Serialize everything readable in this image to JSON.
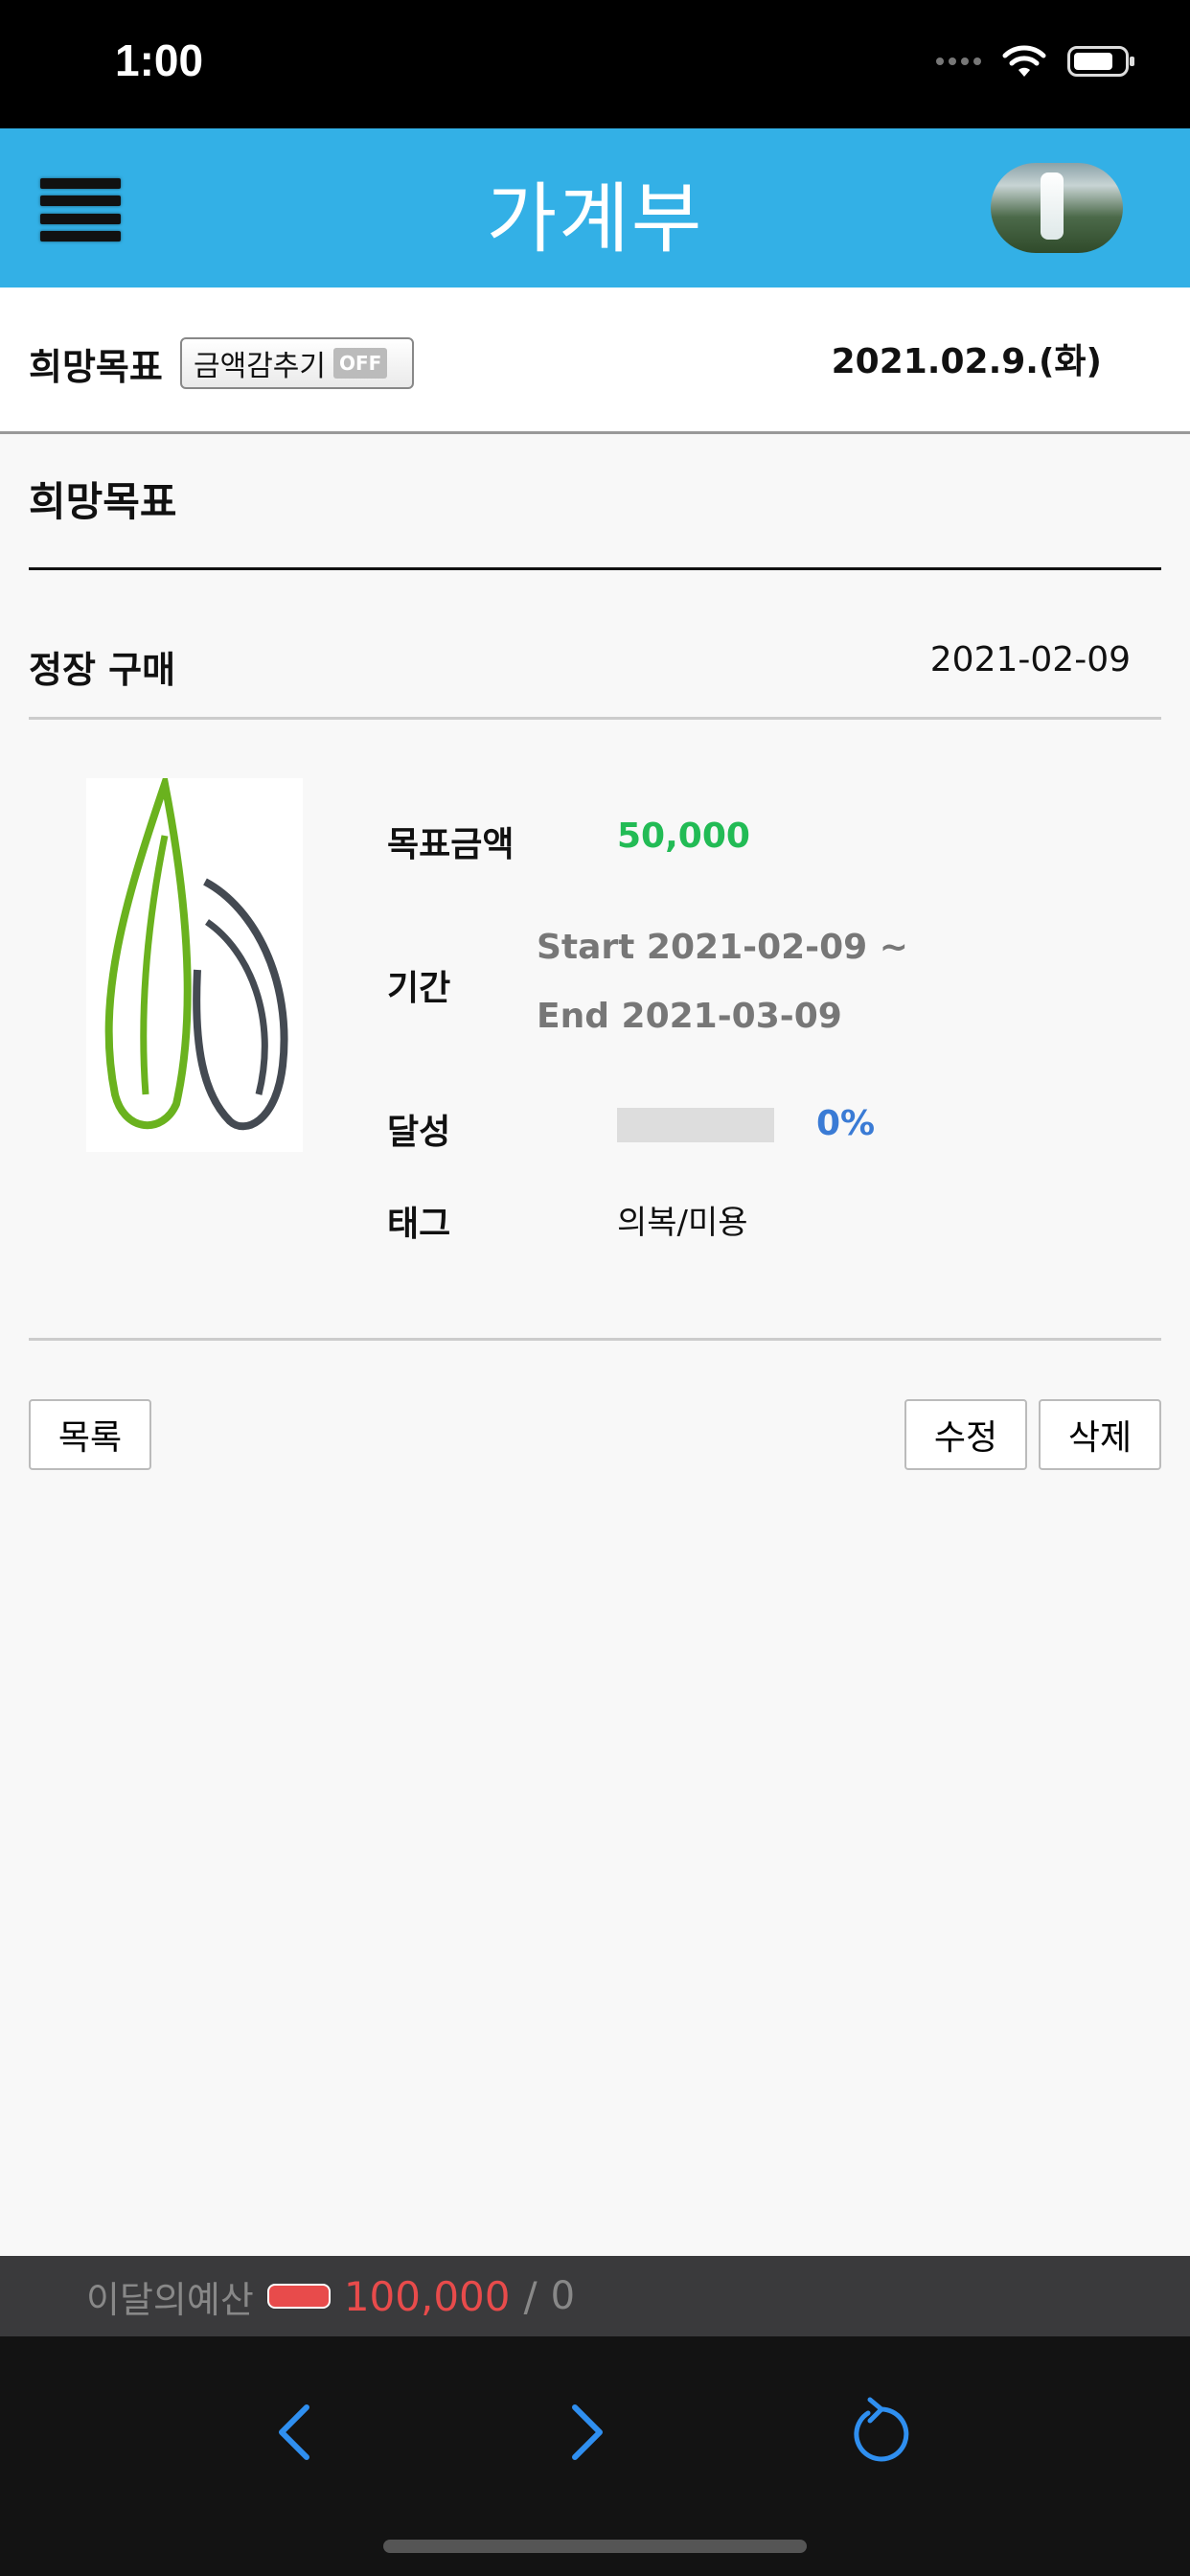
{
  "status_bar": {
    "time": "1:00"
  },
  "header": {
    "title": "가계부"
  },
  "sub_header": {
    "title": "희망목표",
    "toggle_label": "금액감추기",
    "toggle_state": "OFF",
    "date": "2021.02.9.(화)"
  },
  "main": {
    "section_title": "희망목표",
    "item": {
      "name": "정장 구매",
      "date": "2021-02-09"
    },
    "details": {
      "target_label": "목표금액",
      "target_value": "50,000",
      "period_label": "기간",
      "period_start": "Start 2021-02-09 ~",
      "period_end": "End 2021-03-09",
      "achievement_label": "달성",
      "achievement_percent": "0%",
      "achievement_fraction": 0,
      "tag_label": "태그",
      "tag_value": "의복/미용"
    },
    "buttons": {
      "list": "목록",
      "edit": "수정",
      "delete": "삭제"
    }
  },
  "budget": {
    "label": "이달의예산",
    "amount": "100,000",
    "separator": "/",
    "spent": "0"
  },
  "colors": {
    "header": "#33b0e6",
    "target_value": "#22bb55",
    "achievement": "#3a7bd5",
    "budget_amount": "#e84b4b",
    "nav_icon": "#2f8ff0"
  },
  "icons": [
    "menu-icon",
    "avatar",
    "wifi-icon",
    "battery-icon",
    "chevron-left-icon",
    "chevron-right-icon",
    "reload-icon"
  ]
}
